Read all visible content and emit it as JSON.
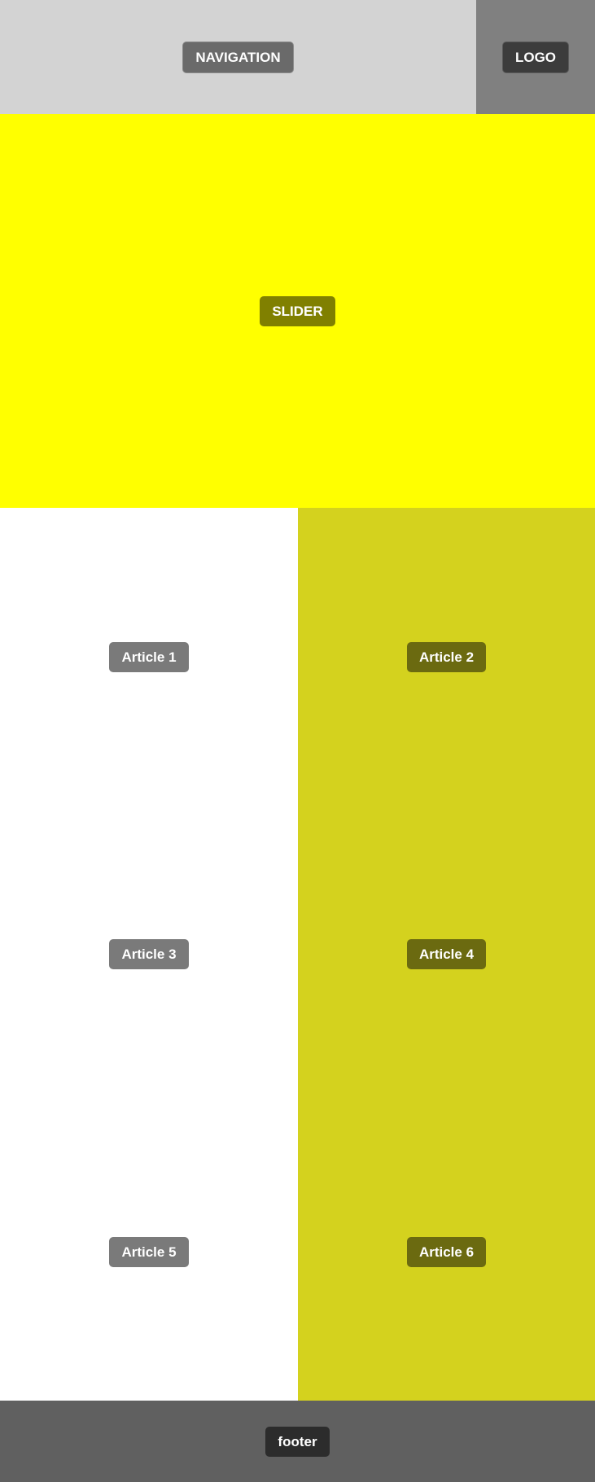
{
  "header": {
    "navigation_label": "NAVIGATION",
    "logo_label": "LOGO"
  },
  "slider": {
    "label": "SLIDER"
  },
  "articles": [
    {
      "label": "Article 1"
    },
    {
      "label": "Article 2"
    },
    {
      "label": "Article 3"
    },
    {
      "label": "Article 4"
    },
    {
      "label": "Article 5"
    },
    {
      "label": "Article 6"
    }
  ],
  "footer": {
    "label": "footer"
  },
  "colors": {
    "navigation_bg": "#d3d3d3",
    "logo_bg": "#808080",
    "slider_bg": "#ffff00",
    "article_left_bg": "#ffffff",
    "article_right_bg": "#d4d21e",
    "footer_bg": "#606060"
  }
}
